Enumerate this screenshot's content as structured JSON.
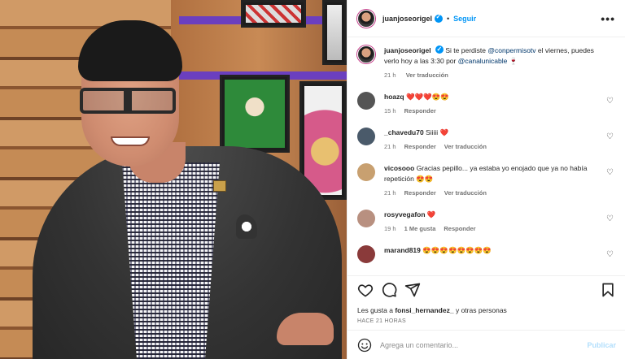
{
  "post": {
    "username": "juanjoseorigel",
    "follow_label": "Seguir",
    "more_label": "•••",
    "dot": "•"
  },
  "caption": {
    "username": "juanjoseorigel",
    "text_1": "Si te perdiste ",
    "mention_1": "@conpermisotv",
    "text_2": " el viernes, puedes verlo hoy a las 3:30 por ",
    "mention_2": "@canalunicable",
    "text_3": " 🍷",
    "time": "21 h",
    "translate": "Ver traducción"
  },
  "comments": [
    {
      "username": "hoazq",
      "text": "❤️❤️❤️😍😍",
      "time": "15 h",
      "likes": "",
      "reply": "Responder",
      "translate": "",
      "avatar": "#555"
    },
    {
      "username": "_chavedu70",
      "text": "Siiiii ❤️",
      "time": "21 h",
      "likes": "",
      "reply": "Responder",
      "translate": "Ver traducción",
      "avatar": "#4a5a6a"
    },
    {
      "username": "vicosooo",
      "text": "Gracias pepillo... ya estaba yo enojado que ya no había repetición 😍😍",
      "time": "21 h",
      "likes": "",
      "reply": "Responder",
      "translate": "Ver traducción",
      "avatar": "#c8a070"
    },
    {
      "username": "rosyvegafon",
      "text": "❤️",
      "time": "19 h",
      "likes": "1 Me gusta",
      "reply": "Responder",
      "translate": "",
      "avatar": "#b89080"
    },
    {
      "username": "marand819",
      "text": "😍😍😍😍😍😍😍😍",
      "time": "",
      "likes": "",
      "reply": "",
      "translate": "",
      "avatar": "#8a3a3a"
    }
  ],
  "engagement": {
    "likes_prefix": "Les gusta a ",
    "likes_user": "fonsi_hernandez_",
    "likes_suffix": " y otras personas",
    "time": "HACE 21 HORAS"
  },
  "composer": {
    "placeholder": "Agrega un comentario...",
    "publish_label": "Publicar"
  },
  "icons": {
    "like": "heart-icon",
    "comment": "comment-icon",
    "share": "share-icon",
    "save": "bookmark-icon",
    "emoji": "emoji-icon"
  },
  "colors": {
    "link_blue": "#0095f6",
    "mention": "#00376b",
    "muted": "#737373",
    "publish_disabled": "#b2dffc"
  }
}
